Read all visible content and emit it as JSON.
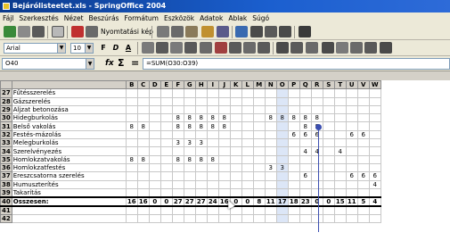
{
  "window": {
    "title": "Bejárólisteetet.xls - SpringOffice 2004"
  },
  "menu": [
    "Fájl",
    "Szerkesztés",
    "Nézet",
    "Beszúrás",
    "Formátum",
    "Eszközök",
    "Adatok",
    "Ablak",
    "Súgó"
  ],
  "toolbar": {
    "print_preview_label": "Nyomtatási kép"
  },
  "format_bar": {
    "font": "Arial",
    "size": "10",
    "bold": "F",
    "italic": "D",
    "underline": "A"
  },
  "formula_bar": {
    "name_box": "O40",
    "fx": "fx",
    "sum": "Σ",
    "eq": "=",
    "formula": "=SUM(O30:O39)"
  },
  "columns": [
    "",
    "",
    "B",
    "C",
    "D",
    "E",
    "F",
    "G",
    "H",
    "I",
    "J",
    "K",
    "L",
    "M",
    "N",
    "O",
    "P",
    "Q",
    "R",
    "S",
    "T",
    "U",
    "V",
    "W"
  ],
  "rows": [
    {
      "n": "27",
      "name": "Fűtésszerelés",
      "cells": [
        "",
        "",
        "",
        "",
        "",
        "",
        "",
        "",
        "",
        "",
        "",
        "",
        "",
        "",
        "",
        "",
        "",
        "",
        "",
        "",
        "",
        ""
      ]
    },
    {
      "n": "28",
      "name": "Gázszerelés",
      "cells": [
        "",
        "",
        "",
        "",
        "",
        "",
        "",
        "",
        "",
        "",
        "",
        "",
        "",
        "",
        "",
        "",
        "",
        "",
        "",
        "",
        "",
        ""
      ]
    },
    {
      "n": "29",
      "name": "Aljzat betonozása",
      "cells": [
        "",
        "",
        "",
        "",
        "",
        "",
        "",
        "",
        "",
        "",
        "",
        "",
        "",
        "",
        "",
        "",
        "",
        "",
        "",
        "",
        "",
        ""
      ]
    },
    {
      "n": "30",
      "name": "Hidegburkolás",
      "cells": [
        "",
        "",
        "",
        "",
        "8",
        "8",
        "8",
        "8",
        "8",
        "",
        "",
        "",
        "8",
        "8",
        "8",
        "8",
        "8",
        "",
        "",
        "",
        "",
        ""
      ]
    },
    {
      "n": "31",
      "name": "Belső vakolás",
      "cells": [
        "8",
        "8",
        "",
        "",
        "8",
        "8",
        "8",
        "8",
        "8",
        "",
        "",
        "",
        "",
        "",
        "",
        "8",
        "8",
        "",
        "",
        "",
        "",
        ""
      ]
    },
    {
      "n": "32",
      "name": "Festés-mázolás",
      "cells": [
        "",
        "",
        "",
        "",
        "",
        "",
        "",
        "",
        "",
        "",
        "",
        "",
        "",
        "",
        "6",
        "6",
        "6",
        "",
        "",
        "6",
        "6",
        ""
      ]
    },
    {
      "n": "33",
      "name": "Melegburkolás",
      "cells": [
        "",
        "",
        "",
        "",
        "3",
        "3",
        "3",
        "",
        "",
        "",
        "",
        "",
        "",
        "",
        "",
        "",
        "",
        "",
        "",
        "",
        "",
        ""
      ]
    },
    {
      "n": "34",
      "name": "Szerelvényezés",
      "cells": [
        "",
        "",
        "",
        "",
        "",
        "",
        "",
        "",
        "",
        "",
        "",
        "",
        "",
        "",
        "",
        "4",
        "4",
        "",
        "4",
        "",
        "",
        ""
      ]
    },
    {
      "n": "35",
      "name": "Homlokzatvakolás",
      "cells": [
        "8",
        "8",
        "",
        "",
        "8",
        "8",
        "8",
        "8",
        "",
        "",
        "",
        "",
        "",
        "",
        "",
        "",
        "",
        "",
        "",
        "",
        "",
        ""
      ]
    },
    {
      "n": "36",
      "name": "Homlokzatfestés",
      "cells": [
        "",
        "",
        "",
        "",
        "",
        "",
        "",
        "",
        "",
        "",
        "",
        "",
        "3",
        "3",
        "",
        "",
        "",
        "",
        "",
        "",
        "",
        ""
      ]
    },
    {
      "n": "37",
      "name": "Ereszcsatorna szerelés",
      "cells": [
        "",
        "",
        "",
        "",
        "",
        "",
        "",
        "",
        "",
        "",
        "",
        "",
        "",
        "",
        "",
        "6",
        "",
        "",
        "",
        "6",
        "6",
        "6"
      ]
    },
    {
      "n": "38",
      "name": "Humuszterítés",
      "cells": [
        "",
        "",
        "",
        "",
        "",
        "",
        "",
        "",
        "",
        "",
        "",
        "",
        "",
        "",
        "",
        "",
        "",
        "",
        "",
        "",
        "",
        "4"
      ]
    },
    {
      "n": "39",
      "name": "Takarítás",
      "cells": [
        "",
        "",
        "",
        "",
        "",
        "",
        "",
        "",
        "",
        "",
        "",
        "",
        "",
        "",
        "",
        "",
        "",
        "",
        "",
        "",
        "",
        ""
      ]
    },
    {
      "n": "40",
      "name": "Összesen:",
      "cells": [
        "16",
        "16",
        "0",
        "0",
        "27",
        "27",
        "27",
        "24",
        "16",
        "0",
        "0",
        "8",
        "11",
        "17",
        "18",
        "23",
        "0",
        "0",
        "15",
        "11",
        "5",
        "4"
      ]
    },
    {
      "n": "41",
      "name": "",
      "cells": [
        "",
        "",
        "",
        "",
        "",
        "",
        "",
        "",
        "",
        "",
        "",
        "",
        "",
        "",
        "",
        "",
        "",
        "",
        "",
        "",
        "",
        ""
      ]
    },
    {
      "n": "42",
      "name": "",
      "cells": [
        "",
        "",
        "",
        "",
        "",
        "",
        "",
        "",
        "",
        "",
        "",
        "",
        "",
        "",
        "",
        "",
        "",
        "",
        "",
        "",
        "",
        ""
      ]
    }
  ],
  "colors": {
    "accent": "#3c4fb0",
    "titlebar": "#1b5fcf"
  }
}
